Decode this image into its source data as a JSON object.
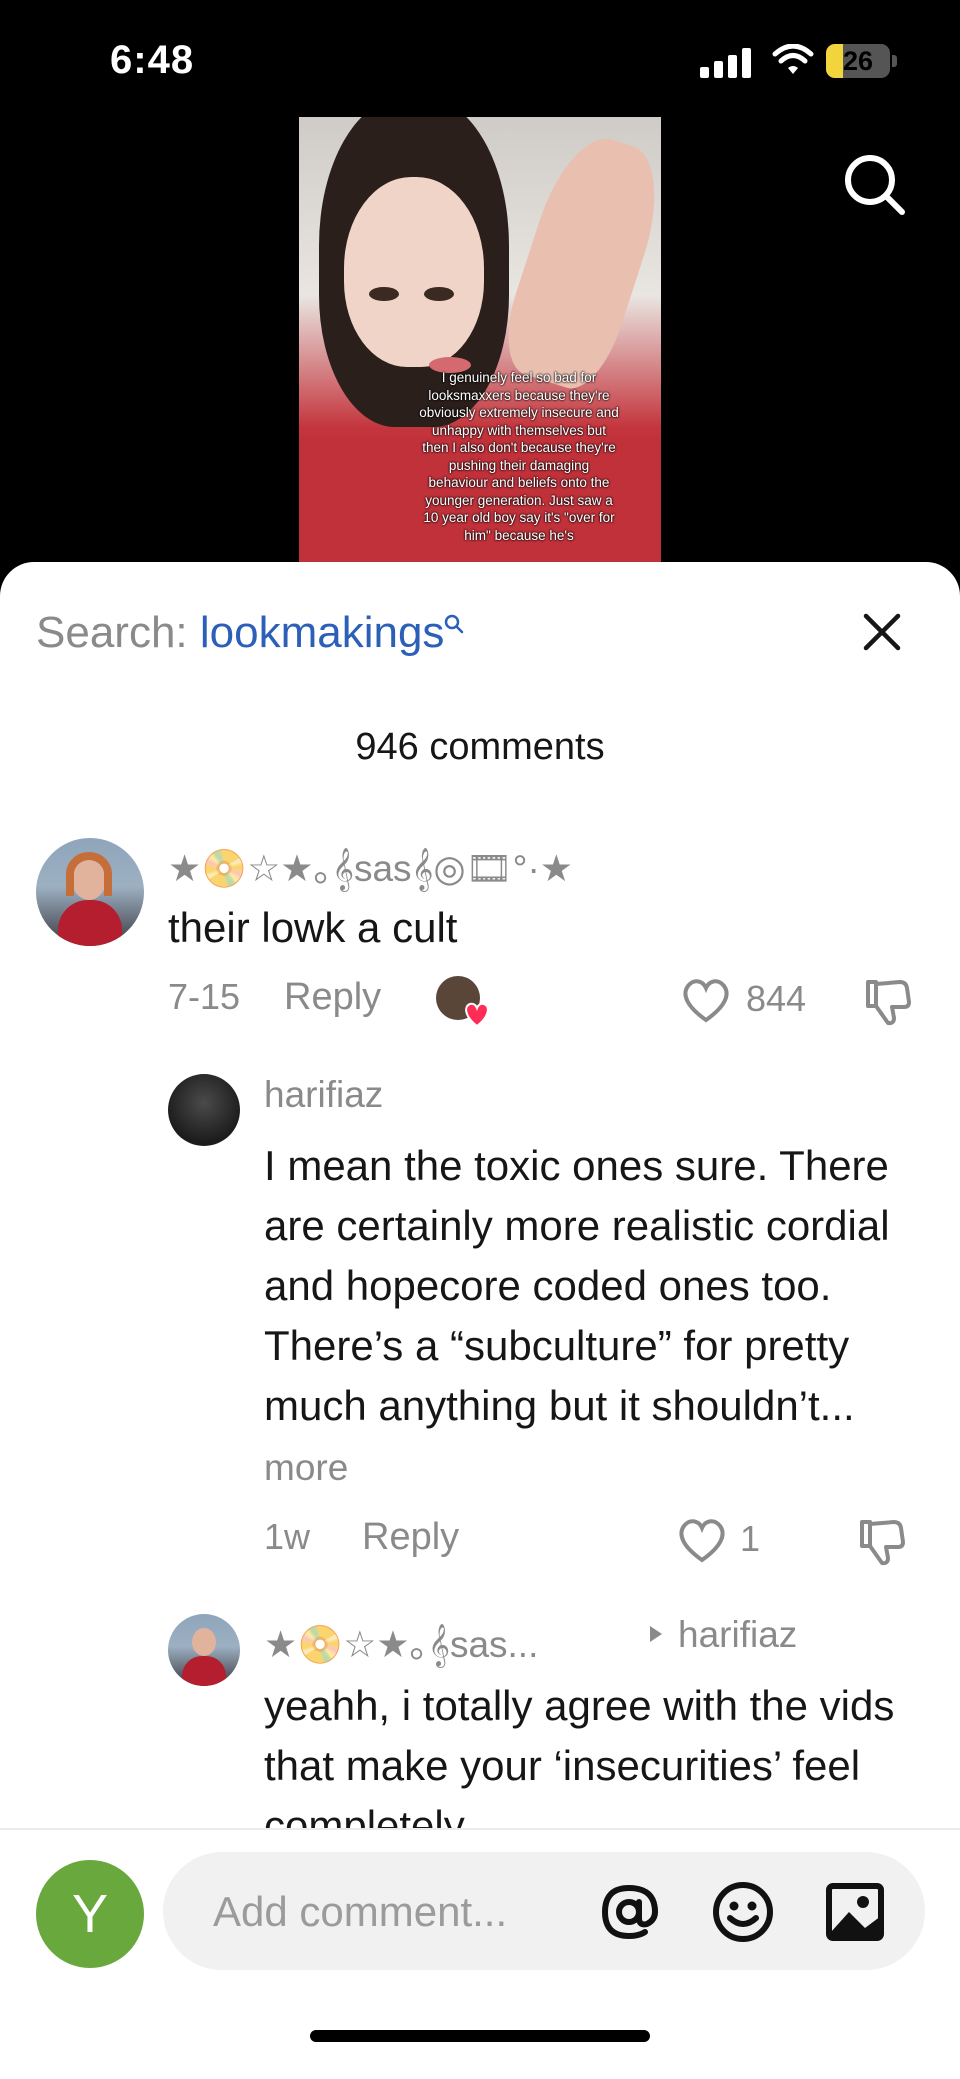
{
  "status": {
    "time": "6:48",
    "battery": "26",
    "battery_level": 0.26
  },
  "video": {
    "caption": "I genuinely feel so bad for looksmaxxers because they're obviously extremely insecure and unhappy with themselves but then I also don't because they're pushing their damaging behaviour and beliefs onto the younger generation. Just saw a 10 year old boy say it's \"over for him\" because he's"
  },
  "search": {
    "prefix": "Search:",
    "query": "lookmakings"
  },
  "comments_header": "946 comments",
  "comments": [
    {
      "username": "★📀☆★｡𝄞sas𝄞◎🎞°·★",
      "text": "their lowk a cult",
      "date": "7-15",
      "reply_label": "Reply",
      "likes": "844"
    },
    {
      "username": "harifiaz",
      "text": "I mean the toxic ones sure. There are certainly more realistic cordial and hopecore coded ones too. There’s a “subculture” for pretty much anything but it shouldn’t...",
      "more": "more",
      "date": "1w",
      "reply_label": "Reply",
      "likes": "1"
    },
    {
      "username": "★📀☆★｡𝄞sas...",
      "reply_to": "harifiaz",
      "text": "yeahh, i totally agree with the vids that make your ‘insecurities’ feel completely"
    }
  ],
  "composer": {
    "avatar_letter": "Y",
    "placeholder": "Add comment..."
  },
  "colors": {
    "accent_blue": "#2c60b8",
    "battery_yellow": "#f2d43c",
    "avatar_green": "#69a83d"
  }
}
